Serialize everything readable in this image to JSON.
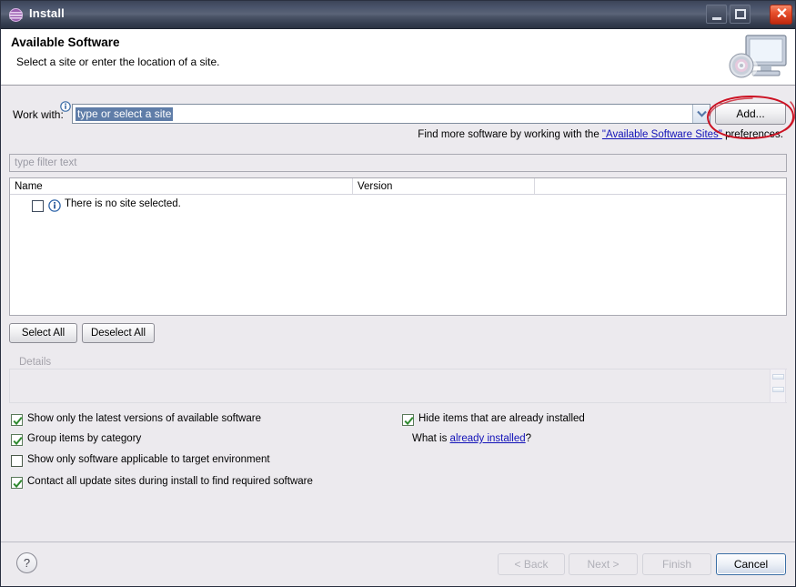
{
  "window": {
    "title": "Install",
    "icon": "eclipse-sphere-icon",
    "controls": {
      "minimize": "minimize-icon",
      "maximize": "maximize-icon",
      "close": "✕"
    }
  },
  "header": {
    "title": "Available Software",
    "subtitle": "Select a site or enter the location of a site.",
    "graphic": "monitor-with-disc-icon"
  },
  "work_with": {
    "label": "Work with:",
    "info_icon": "info-icon",
    "value": "type or select a site",
    "placeholder": "type or select a site",
    "dropdown_icon": "chevron-down-icon",
    "add_button": "Add..."
  },
  "find_more": {
    "prefix": "Find more software by working with the ",
    "link": "\"Available Software Sites\"",
    "suffix": " preferences."
  },
  "filter": {
    "placeholder": "type filter text",
    "value": ""
  },
  "table": {
    "columns": [
      "Name",
      "Version",
      ""
    ],
    "rows": [
      {
        "checked": false,
        "icon": "info-icon",
        "name": "There is no site selected.",
        "version": ""
      }
    ]
  },
  "selection_buttons": {
    "select_all": "Select All",
    "deselect_all": "Deselect All"
  },
  "details": {
    "label": "Details",
    "content": "",
    "enabled": false
  },
  "options_left": [
    {
      "label": "Show only the latest versions of available software",
      "checked": true
    },
    {
      "label": "Group items by category",
      "checked": true
    },
    {
      "label": "Show only software applicable to target environment",
      "checked": false
    },
    {
      "label": "Contact all update sites during install to find required software",
      "checked": true
    }
  ],
  "options_right": [
    {
      "label": "Hide items that are already installed",
      "checked": true
    }
  ],
  "already_installed": {
    "prefix": "What is ",
    "link": "already installed",
    "suffix": "?"
  },
  "footer": {
    "help": "?",
    "back": "< Back",
    "next": "Next >",
    "finish": "Finish",
    "cancel": "Cancel"
  },
  "colors": {
    "titlebar_dark": "#2b3342",
    "titlebar_light": "#5b6478",
    "close_red": "#e8502c",
    "dialog_bg": "#eceaee",
    "link_blue": "#1212b8",
    "selection_blue": "#5f7da8",
    "check_green": "#2f8a2f",
    "annotation_red": "#cc1122",
    "disabled_gray": "#b0b0b8"
  },
  "annotation": {
    "shape": "hand-drawn-ellipse",
    "target": "add-button",
    "color": "#cc1122"
  }
}
